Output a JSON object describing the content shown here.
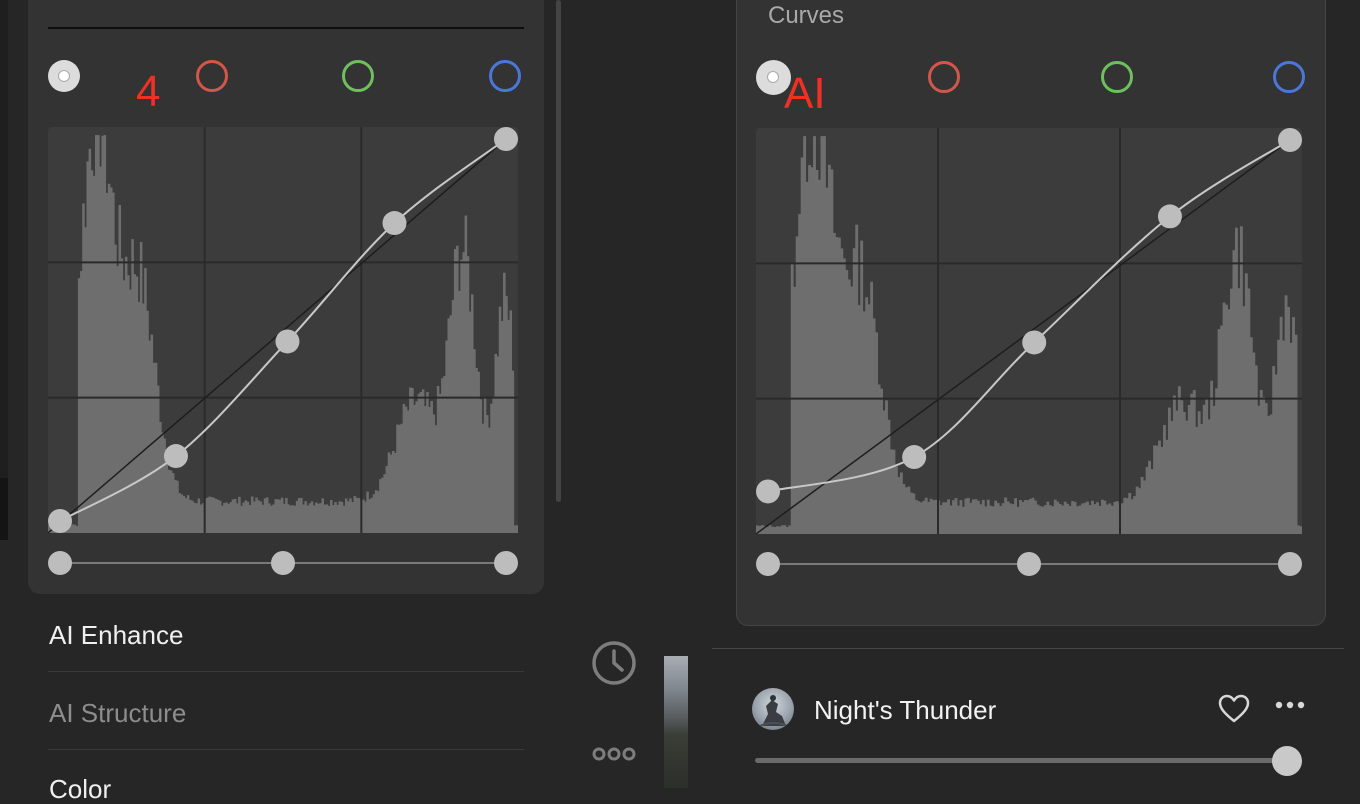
{
  "left_panel": {
    "annotation": "4",
    "channels": [
      {
        "name": "rgb-channel",
        "color": "#dcdcdc"
      },
      {
        "name": "red-channel",
        "color": "#d1574a"
      },
      {
        "name": "green-channel",
        "color": "#6fbf5f"
      },
      {
        "name": "blue-channel",
        "color": "#4b78d8"
      }
    ],
    "curve_points": [
      [
        0,
        0
      ],
      [
        0.26,
        0.17
      ],
      [
        0.51,
        0.47
      ],
      [
        0.75,
        0.78
      ],
      [
        1,
        1
      ]
    ],
    "menu": [
      {
        "label": "AI Enhance",
        "state": "active"
      },
      {
        "label": "AI Structure",
        "state": "dimmed"
      },
      {
        "label": "Color",
        "state": "active"
      }
    ],
    "icons": {
      "history": "clock-icon",
      "more": "more-horizontal-icon"
    }
  },
  "right_panel": {
    "section_title": "Curves",
    "annotation": "AI",
    "channels": [
      {
        "name": "rgb-channel",
        "color": "#dcdcdc"
      },
      {
        "name": "red-channel",
        "color": "#d1574a"
      },
      {
        "name": "green-channel",
        "color": "#6fbf5f"
      },
      {
        "name": "blue-channel",
        "color": "#4b78d8"
      }
    ],
    "curve_points": [
      [
        0,
        0.08
      ],
      [
        0.28,
        0.17
      ],
      [
        0.51,
        0.47
      ],
      [
        0.77,
        0.8
      ],
      [
        1,
        1
      ]
    ],
    "preset": {
      "name": "Night's Thunder",
      "amount": 1.0,
      "icons": {
        "favorite": "heart-icon",
        "more": "more-horizontal-icon"
      }
    }
  }
}
